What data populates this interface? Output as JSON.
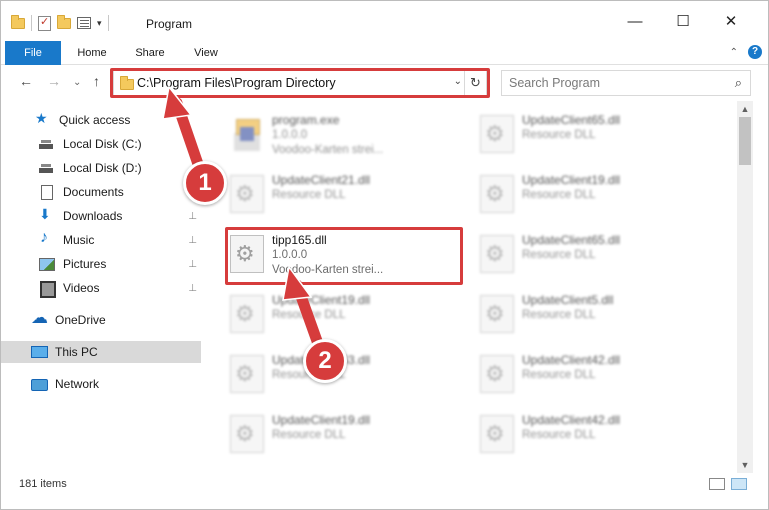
{
  "window": {
    "title": "Program",
    "minimize": "—",
    "maximize": "☐",
    "close": "✕"
  },
  "ribbon": {
    "tabs": [
      "File",
      "Home",
      "Share",
      "View"
    ]
  },
  "address": {
    "path": "C:\\Program Files\\Program Directory",
    "dropdown": "⌄",
    "refresh": "↻"
  },
  "search": {
    "placeholder": "Search Program",
    "icon": "⌕"
  },
  "nav_buttons": {
    "back": "←",
    "forward": "→",
    "recent": "⌄",
    "up": "↑"
  },
  "sidebar": {
    "items": [
      {
        "label": "Quick access",
        "icon": "star-icon",
        "pinned": false
      },
      {
        "label": "Local Disk (C:)",
        "icon": "disk-icon",
        "pinned": false
      },
      {
        "label": "Local Disk (D:)",
        "icon": "disk-icon",
        "pinned": false
      },
      {
        "label": "Documents",
        "icon": "documents-icon",
        "pinned": false
      },
      {
        "label": "Downloads",
        "icon": "downloads-icon",
        "pinned": true
      },
      {
        "label": "Music",
        "icon": "music-icon",
        "pinned": true
      },
      {
        "label": "Pictures",
        "icon": "pictures-icon",
        "pinned": true
      },
      {
        "label": "Videos",
        "icon": "videos-icon",
        "pinned": true
      },
      {
        "label": "OneDrive",
        "icon": "onedrive-icon",
        "pinned": false
      },
      {
        "label": "This PC",
        "icon": "pc-icon",
        "pinned": false,
        "selected": true
      },
      {
        "label": "Network",
        "icon": "network-icon",
        "pinned": false
      }
    ],
    "pin_glyph": "📌"
  },
  "files": {
    "left": [
      {
        "name": "program.exe",
        "version": "1.0.0.0",
        "desc": "Voodoo-Karten strei...",
        "type": "exe",
        "blurred": true
      },
      {
        "name": "UpdateClient21.dll",
        "version": "Resource DLL",
        "desc": "",
        "type": "dll",
        "blurred": true
      },
      {
        "name": "tipp165.dll",
        "version": "1.0.0.0",
        "desc": "Voodoo-Karten strei...",
        "type": "dll",
        "blurred": false
      },
      {
        "name": "UpdateClient19.dll",
        "version": "Resource DLL",
        "desc": "",
        "type": "dll",
        "blurred": true
      },
      {
        "name": "UpdateClient63.dll",
        "version": "Resource DLL",
        "desc": "",
        "type": "dll",
        "blurred": true
      },
      {
        "name": "UpdateClient19.dll",
        "version": "Resource DLL",
        "desc": "",
        "type": "dll",
        "blurred": true
      }
    ],
    "right": [
      {
        "name": "UpdateClient65.dll",
        "version": "Resource DLL",
        "desc": "",
        "type": "dll",
        "blurred": true
      },
      {
        "name": "UpdateClient19.dll",
        "version": "Resource DLL",
        "desc": "",
        "type": "dll",
        "blurred": true
      },
      {
        "name": "UpdateClient65.dll",
        "version": "Resource DLL",
        "desc": "",
        "type": "dll",
        "blurred": true
      },
      {
        "name": "UpdateClient5.dll",
        "version": "Resource DLL",
        "desc": "",
        "type": "dll",
        "blurred": true
      },
      {
        "name": "UpdateClient42.dll",
        "version": "Resource DLL",
        "desc": "",
        "type": "dll",
        "blurred": true
      },
      {
        "name": "UpdateClient42.dll",
        "version": "Resource DLL",
        "desc": "",
        "type": "dll",
        "blurred": true
      }
    ]
  },
  "status": {
    "count": "181 items"
  },
  "annotations": {
    "step1": "1",
    "step2": "2",
    "color": "#d63c3c"
  }
}
